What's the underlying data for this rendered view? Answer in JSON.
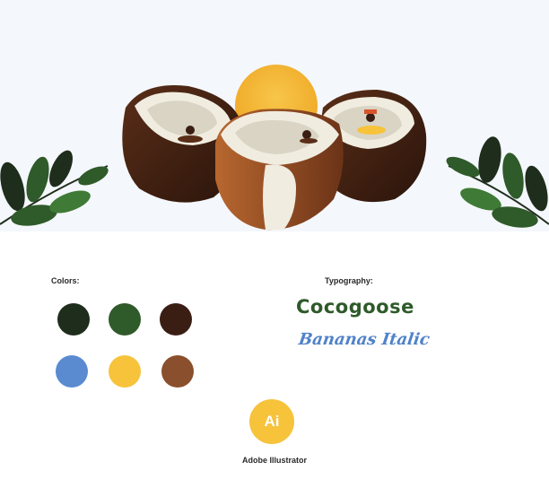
{
  "colors_section": {
    "label": "Colors:",
    "swatches": [
      "#1f2d1c",
      "#2f5a2a",
      "#3a1e14",
      "#5a8bd1",
      "#f6c33b",
      "#8a4f2c"
    ]
  },
  "typography_section": {
    "label": "Typography:",
    "fonts": [
      "Cocogoose",
      "Bananas Italic"
    ]
  },
  "tool": {
    "badge": "Ai",
    "name": "Adobe Illustrator"
  },
  "illustration": {
    "sky_color": "#f4f7fb",
    "sun_color": "#f4b733",
    "shell_color": "#3b1e12",
    "flesh_color": "#f0ece0",
    "leaf_color": "#2f5a2a"
  }
}
